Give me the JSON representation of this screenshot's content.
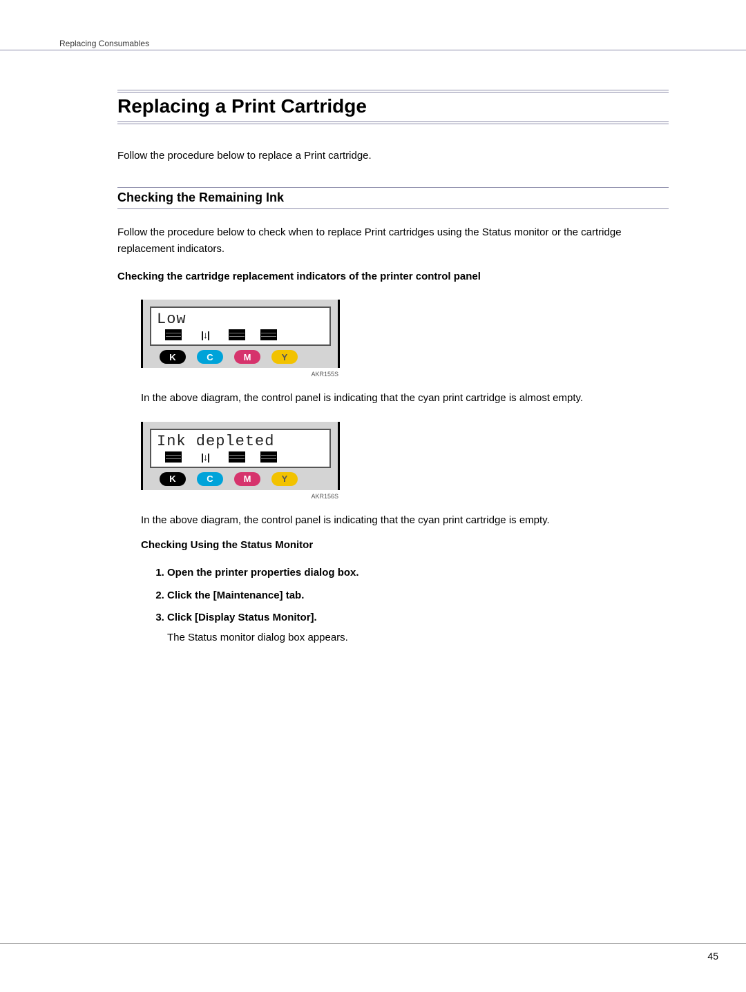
{
  "header": {
    "breadcrumb": "Replacing Consumables"
  },
  "page": {
    "number": "45"
  },
  "title": "Replacing a Print Cartridge",
  "intro": "Follow the procedure below to replace a Print cartridge.",
  "section1": {
    "heading": "Checking the Remaining Ink",
    "para": "Follow the procedure below to check when to replace Print cartridges using the Status monitor or the cartridge replacement indicators.",
    "sub1_heading": "Checking the cartridge replacement indicators of the printer control panel",
    "diagram1": {
      "lcd_text": "Low",
      "code": "AKR155S",
      "labels": {
        "k": "K",
        "c": "C",
        "m": "M",
        "y": "Y"
      }
    },
    "caption1": "In the above diagram, the control panel is indicating that the cyan print cartridge is almost empty.",
    "diagram2": {
      "lcd_text": "Ink depleted",
      "code": "AKR156S",
      "labels": {
        "k": "K",
        "c": "C",
        "m": "M",
        "y": "Y"
      }
    },
    "caption2": "In the above diagram, the control panel is indicating that the cyan print cartridge is empty.",
    "sub2_heading": "Checking Using the Status Monitor",
    "steps": {
      "s1": "Open the printer properties dialog box.",
      "s2": "Click the [Maintenance] tab.",
      "s3": "Click [Display Status Monitor].",
      "s3_sub": "The Status monitor dialog box appears."
    }
  }
}
